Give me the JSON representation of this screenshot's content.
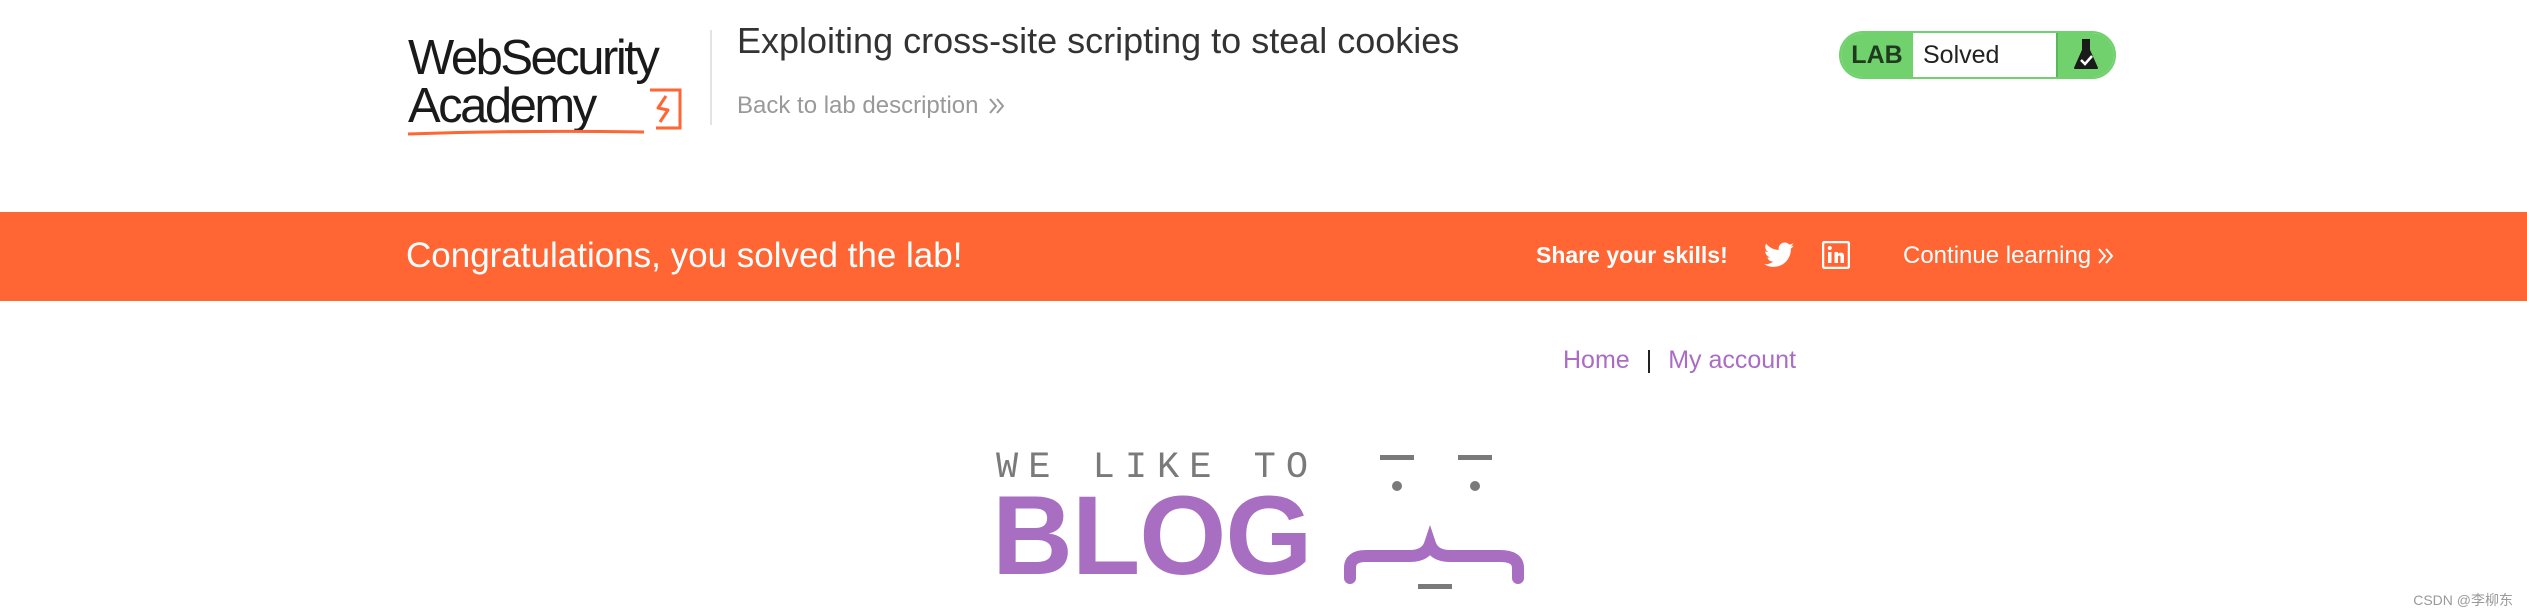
{
  "header": {
    "logo_line1": "WebSecurity",
    "logo_line2": "Academy",
    "lab_title": "Exploiting cross-site scripting to steal cookies",
    "back_link": "Back to lab description",
    "status": {
      "tag": "LAB",
      "text": "Solved",
      "color": "#70d16d"
    }
  },
  "banner": {
    "message": "Congratulations, you solved the lab!",
    "share_label": "Share your skills!",
    "continue_label": "Continue learning",
    "color": "#ff6633"
  },
  "nav": {
    "home": "Home",
    "separator": "|",
    "my_account": "My account",
    "link_color": "#aa6cc4"
  },
  "blog_header": {
    "tagline": "WE LIKE TO",
    "word": "BLOG",
    "accent": "#a86ec2"
  },
  "watermark": "CSDN @李柳东"
}
